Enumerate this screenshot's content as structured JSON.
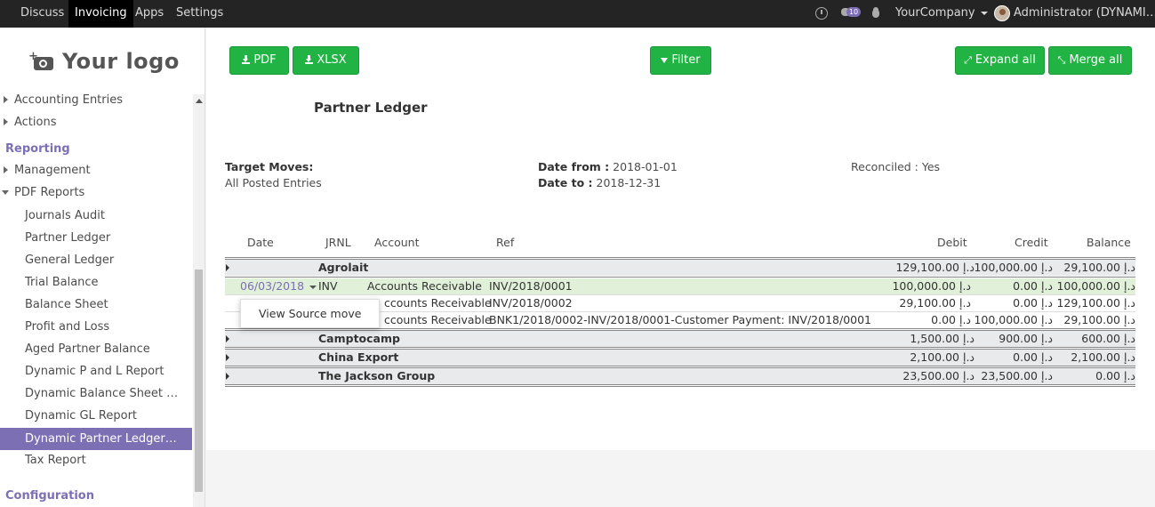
{
  "navbar": {
    "menus": [
      "Discuss",
      "Invoicing",
      "Apps",
      "Settings"
    ],
    "active": "Invoicing",
    "chat_badge": "10",
    "company": "YourCompany",
    "user": "Administrator (DYNAMI…"
  },
  "sidebar": {
    "logo_text": "Your logo",
    "items": [
      {
        "label": "Accounting Entries"
      },
      {
        "label": "Actions"
      },
      {
        "label": "Reporting"
      },
      {
        "label": "Management"
      },
      {
        "label": "PDF Reports"
      },
      {
        "label": "Journals Audit"
      },
      {
        "label": "Partner Ledger"
      },
      {
        "label": "General Ledger"
      },
      {
        "label": "Trial Balance"
      },
      {
        "label": "Balance Sheet"
      },
      {
        "label": "Profit and Loss"
      },
      {
        "label": "Aged Partner Balance"
      },
      {
        "label": "Dynamic P and L Report"
      },
      {
        "label": "Dynamic Balance Sheet …"
      },
      {
        "label": "Dynamic GL Report"
      },
      {
        "label": "Dynamic Partner Ledger…"
      },
      {
        "label": "Tax Report"
      },
      {
        "label": "Configuration"
      }
    ],
    "selected": "Dynamic Partner Ledger…"
  },
  "toolbar": {
    "pdf_label": "PDF",
    "xlsx_label": "XLSX",
    "filter_label": "Filter",
    "expand_label": "Expand all",
    "merge_label": "Merge all"
  },
  "report": {
    "title": "Partner Ledger",
    "target_moves_label": "Target Moves:",
    "target_moves_value": "All Posted Entries",
    "date_from_label": "Date from :",
    "date_from_value": "2018-01-01",
    "date_to_label": "Date to :",
    "date_to_value": "2018-12-31",
    "reconciled_text": "Reconciled : Yes"
  },
  "table": {
    "columns": [
      "Date",
      "JRNL",
      "Account",
      "Ref",
      "Debit",
      "Credit",
      "Balance"
    ],
    "groups": [
      {
        "name": "Agrolait",
        "debit": "129,100.00 د.إ",
        "credit": "100,000.00 د.إ",
        "balance": "29,100.00 د.إ"
      },
      {
        "name": "Camptocamp",
        "debit": "1,500.00 د.إ",
        "credit": "900.00 د.إ",
        "balance": "600.00 د.إ"
      },
      {
        "name": "China Export",
        "debit": "2,100.00 د.إ",
        "credit": "0.00 د.إ",
        "balance": "2,100.00 د.إ"
      },
      {
        "name": "The Jackson Group",
        "debit": "23,500.00 د.إ",
        "credit": "23,500.00 د.إ",
        "balance": "0.00 د.إ"
      }
    ],
    "lines": [
      {
        "date": "06/03/2018",
        "jrnl": "INV",
        "account": "Accounts Receivable",
        "ref": "INV/2018/0001",
        "debit": "100,000.00 د.إ",
        "credit": "0.00 د.إ",
        "balance": "100,000.00 د.إ"
      },
      {
        "date": "",
        "jrnl": "",
        "account": "ccounts Receivable",
        "ref": "INV/2018/0002",
        "debit": "29,100.00 د.إ",
        "credit": "0.00 د.إ",
        "balance": "129,100.00 د.إ"
      },
      {
        "date": "",
        "jrnl": "",
        "account": "ccounts Receivable",
        "ref": "BNK1/2018/0002-INV/2018/0001-Customer Payment: INV/2018/0001",
        "debit": "0.00 د.إ",
        "credit": "100,000.00 د.إ",
        "balance": "29,100.00 د.إ"
      }
    ],
    "dropdown_item": "View Source move"
  },
  "colors": {
    "accent": "#7c6fb4",
    "button_green": "#21b343",
    "navbar": "#242424"
  }
}
